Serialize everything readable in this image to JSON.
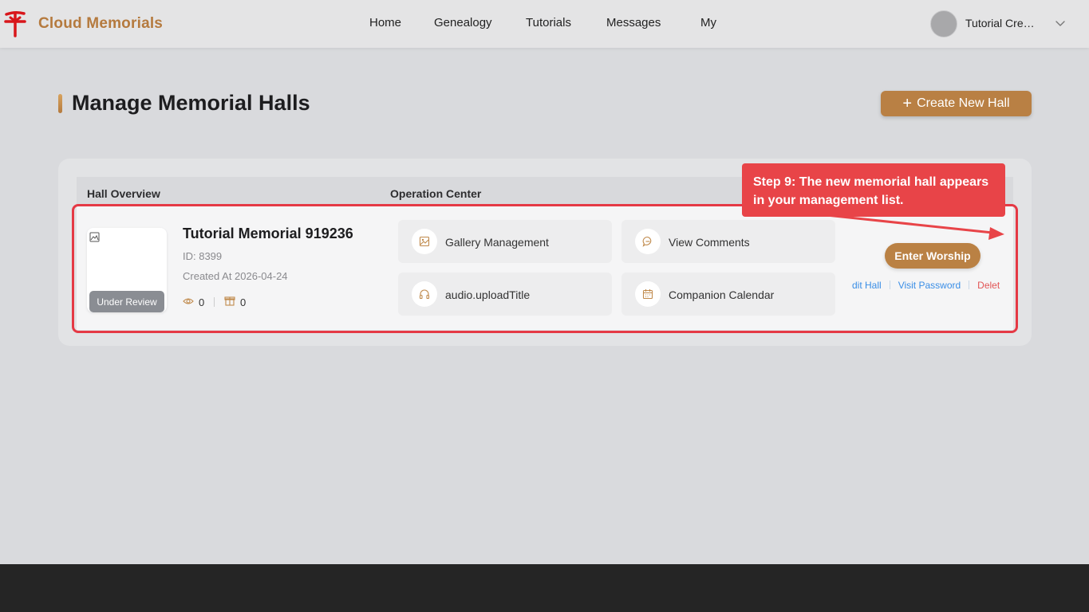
{
  "header": {
    "brand": "Cloud Memorials",
    "nav": [
      "Home",
      "Genealogy",
      "Tutorials",
      "Messages",
      "My"
    ],
    "user_name": "Tutorial Creat..."
  },
  "page": {
    "title": "Manage Memorial Halls",
    "create_label": "Create New Hall"
  },
  "table": {
    "col_overview": "Hall Overview",
    "col_operation": "Operation Center"
  },
  "hall": {
    "name": "Tutorial Memorial 919236",
    "id": "ID: 8399",
    "created": "Created At 2026-04-24",
    "status": "Under Review",
    "views": "0",
    "gifts": "0"
  },
  "operations": {
    "gallery": "Gallery Management",
    "comments": "View Comments",
    "audio": "audio.uploadTitle",
    "calendar": "Companion Calendar"
  },
  "actions": {
    "enter": "Enter Worship",
    "edit": "dit Hall",
    "password": "Visit Password",
    "delete": "Delet"
  },
  "callout": {
    "text": "Step 9: The new memorial hall appears in your management list."
  },
  "colors": {
    "brand": "#b57a3e",
    "accent_button": "#b98044",
    "highlight": "#e53945",
    "link": "#3a8ee6",
    "danger": "#e25555"
  }
}
